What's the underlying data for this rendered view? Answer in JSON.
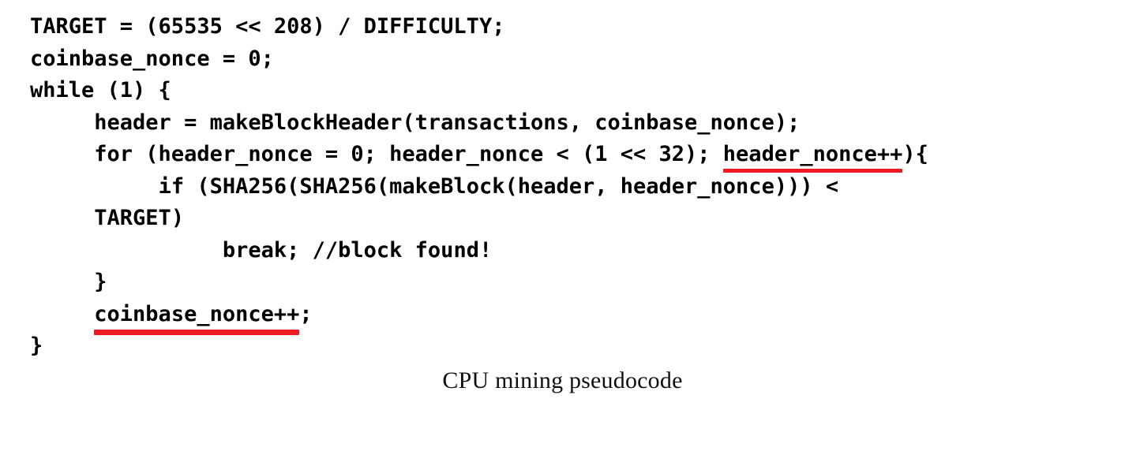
{
  "code": {
    "language": "pseudocode",
    "lines": [
      {
        "indent": 0,
        "text": "TARGET = (65535 << 208) / DIFFICULTY;"
      },
      {
        "indent": 0,
        "text": "coinbase_nonce = 0;"
      },
      {
        "indent": 0,
        "text": "while (1) {"
      },
      {
        "indent": 1,
        "text": "header = makeBlockHeader(transactions, coinbase_nonce);"
      },
      {
        "indent": 1,
        "text": "for (header_nonce = 0; header_nonce < (1 << 32); ",
        "annotated": "header_nonce++",
        "after": "){"
      },
      {
        "indent": 2,
        "text": "if (SHA256(SHA256(makeBlock(header, header_nonce))) <"
      },
      {
        "indent": 1,
        "text": "TARGET)"
      },
      {
        "indent": 3,
        "text": "break; //block found!"
      },
      {
        "indent": 1,
        "text": "}"
      },
      {
        "indent": 1,
        "text": "",
        "annotated": "coinbase_nonce++",
        "after": ";",
        "thick": true
      },
      {
        "indent": 0,
        "text": "}"
      }
    ]
  },
  "annotations": {
    "highlight_color": "#ee1b24",
    "items": [
      {
        "label": "header_nonce++",
        "style": "red-underline"
      },
      {
        "label": "coinbase_nonce++",
        "style": "red-underline-thick"
      }
    ]
  },
  "caption": {
    "text": "CPU mining pseudocode"
  }
}
